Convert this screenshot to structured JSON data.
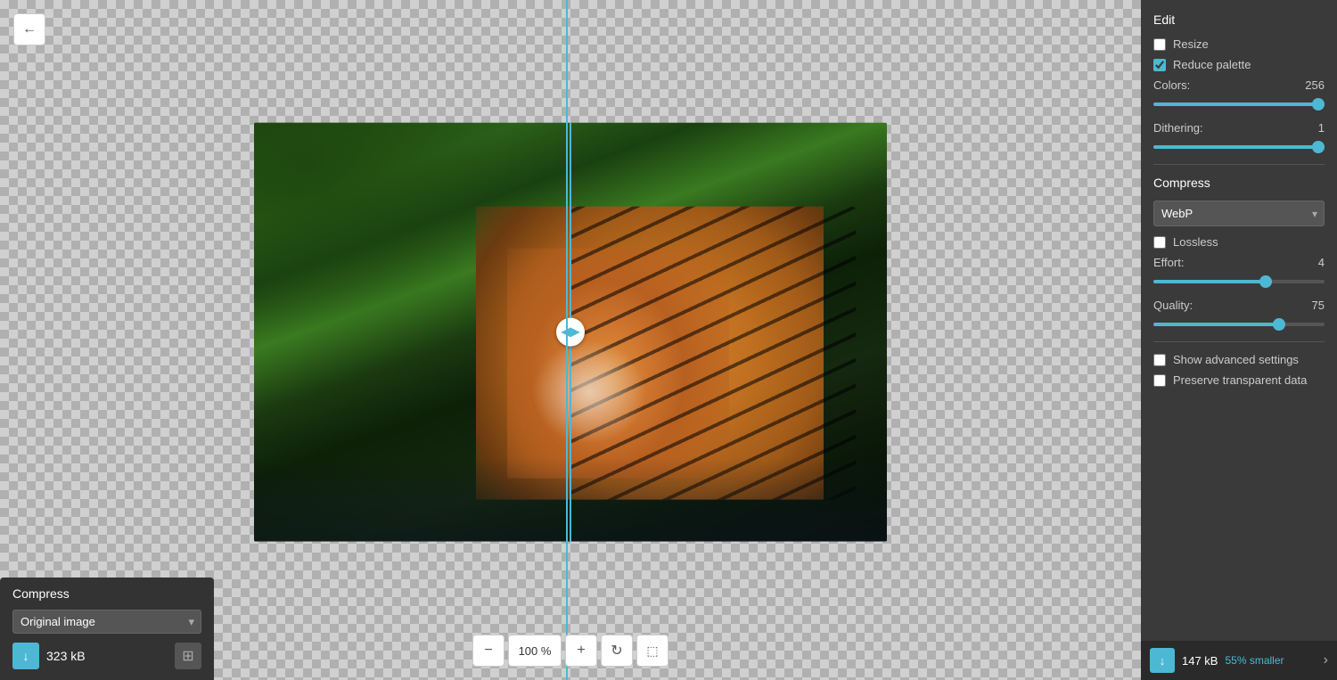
{
  "back_button": {
    "icon": "←"
  },
  "zoom": {
    "minus": "−",
    "value": "100 %",
    "plus": "+",
    "rotate_icon": "↻",
    "frame_icon": "⛶"
  },
  "compress_panel": {
    "title": "Compress",
    "select_value": "Original image",
    "file_size": "323 kB",
    "download_icon": "↓",
    "upload_icon": "⊞"
  },
  "right_panel": {
    "edit_title": "Edit",
    "resize_label": "Resize",
    "resize_checked": false,
    "reduce_palette_label": "Reduce palette",
    "reduce_palette_checked": true,
    "colors_label": "Colors:",
    "colors_value": "256",
    "colors_slider_pct": 100,
    "dithering_label": "Dithering:",
    "dithering_value": "1",
    "dithering_slider_pct": 100,
    "compress_title": "Compress",
    "format_value": "WebP",
    "lossless_label": "Lossless",
    "lossless_checked": false,
    "effort_label": "Effort:",
    "effort_value": "4",
    "effort_slider_pct": 75,
    "quality_label": "Quality:",
    "quality_value": "75",
    "quality_slider_pct": 75,
    "show_advanced_label": "Show advanced settings",
    "show_advanced_checked": false,
    "preserve_transparent_label": "Preserve transparent data",
    "preserve_transparent_checked": false
  },
  "bottom_bar": {
    "save_icon": "↓",
    "file_size": "147 kB",
    "smaller_text": "55% smaller",
    "arrow_icon": "›"
  },
  "colors": {
    "accent": "#4db8d4",
    "panel_bg": "#3a3a3a",
    "dark_bg": "#2a2a2a",
    "text_light": "#cccccc",
    "text_white": "#ffffff"
  }
}
